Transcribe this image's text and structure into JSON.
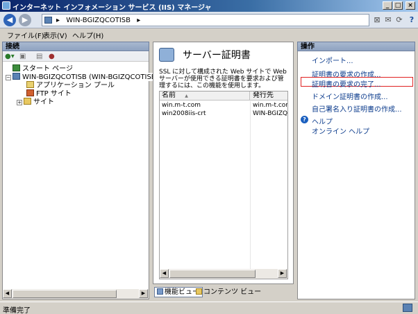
{
  "window": {
    "title": "インターネット インフォメーション サービス (IIS) マネージャ"
  },
  "address": {
    "path": "WIN-BGIZQCOTISB",
    "separator": "▸",
    "trailing": "▸"
  },
  "menu": {
    "file": "ファイル(F)",
    "view": "表示(V)",
    "help": "ヘルプ(H)"
  },
  "connections": {
    "header": "接続",
    "tree": [
      {
        "label": "スタート ページ"
      },
      {
        "label": "WIN-BGIZQCOTISB (WIN-BGIZQCOTISB¥Admir"
      },
      {
        "label": "アプリケーション プール"
      },
      {
        "label": "FTP サイト"
      },
      {
        "label": "サイト"
      }
    ]
  },
  "feature": {
    "title": "サーバー証明書",
    "description": "SSL に対して構成された Web サイトで Web サーバーが使用できる証明書を要求および管理するには、この機能を使用します。",
    "columns": {
      "name": "名前",
      "sort_arrow": "▲",
      "issued_to": "発行先"
    },
    "rows": [
      {
        "name": "win.m-t.com",
        "issued_to": "win.m-t.com"
      },
      {
        "name": "win2008iis-crt",
        "issued_to": "WIN-BGIZQC"
      }
    ],
    "tabs": {
      "features_view": "機能ビュー",
      "content_view": "コンテンツ ビュー"
    }
  },
  "actions": {
    "header": "操作",
    "items": [
      "インポート...",
      "証明書の要求の作成...",
      "証明書の要求の完了...",
      "ドメイン証明書の作成...",
      "自己署名入り証明書の作成..."
    ],
    "help_label": "ヘルプ",
    "online_help_label": "オンライン ヘルプ"
  },
  "status": {
    "text": "準備完了"
  },
  "colors": {
    "highlight_border": "#e02020",
    "link": "#0b3b8c"
  }
}
